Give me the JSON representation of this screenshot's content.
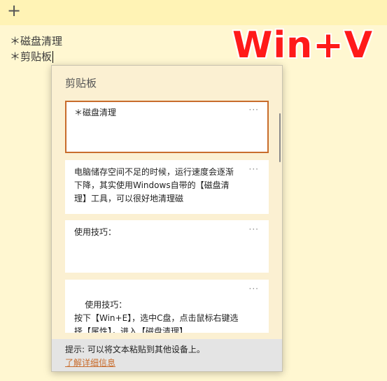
{
  "note": {
    "add_label": "+",
    "lines": [
      "＊磁盘清理",
      "＊剪贴板"
    ]
  },
  "overlay": {
    "hotkey": "Win+V"
  },
  "clipboard": {
    "title": "剪贴板",
    "more_label": "···",
    "items": [
      {
        "text": "＊磁盘清理"
      },
      {
        "text": "电脑储存空间不足的时候，运行速度会逐渐下降，其实使用Windows自带的【磁盘清理】工具，可以很好地清理磁"
      },
      {
        "text": "使用技巧："
      },
      {
        "text": "使用技巧：\n按下【Win+E】，选中C盘，点击鼠标右键选择【属性】，进入【磁盘清理】"
      }
    ],
    "tip": "提示: 可以将文本粘贴到其他设备上。",
    "learn_more": "了解详细信息"
  },
  "colors": {
    "accent": "#c86c2c",
    "overlay_red": "#ff1a1a",
    "note_background": "#fff7d1"
  }
}
